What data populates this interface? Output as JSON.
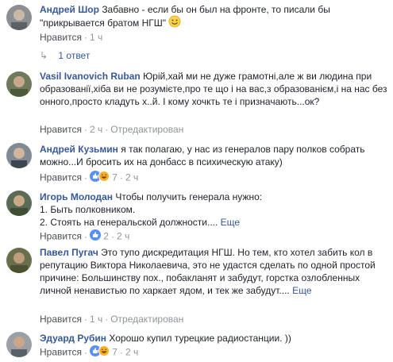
{
  "comments": [
    {
      "author": "Андрей Шор",
      "text": "Забавно - если бы он был на фронте, то писали бы \"прикрывается братом НГШ\"",
      "emoji": "smile-emoji",
      "like": "Нравится",
      "time": "1 ч",
      "replies": "1 ответ"
    },
    {
      "author": "Vasil Ivanovich Ruban",
      "text": "Юрій,хай ми не дуже грамотні,але ж ви людина при образованії,хіба ви не розумієте,про те що і на вас,з образованієм,і на нас без онного,просто кладуть х..й. І кому хочкть те і призначають...ок?",
      "like": "Нравится",
      "time": "2 ч",
      "edited": "Отредактирован"
    },
    {
      "author": "Андрей Кузьмин",
      "text": "я так полагаю, у нас из генералов пару полков собрать можно...И бросить их на донбасс в психическую атаку)",
      "like": "Нравится",
      "reaction_count": "7",
      "time": "2 ч"
    },
    {
      "author": "Игорь Молодан",
      "text_intro": "Чтобы получить генерала нужно:",
      "text_line1": "1. Быть полковником.",
      "text_line2": "2. Стоять на генеральской должности....",
      "more": "Еще",
      "like": "Нравится",
      "reaction_count": "2",
      "time": "2 ч"
    },
    {
      "author": "Павел Пугач",
      "text": "Это тупо дискредитация НГШ. Но тем, кто хотел забить кол в репутацию Виктора Николаевича, это не удастся сделать по одной простой причине: Большинству пох., побакланят и забудут, горстка озлобленных личной ненавистью по харкает ядом, и тек же забудут....",
      "more": "Еще",
      "like": "Нравится",
      "time": "1 ч",
      "edited": "Отредактирован"
    },
    {
      "author": "Эдуард Рубин",
      "text": "Хорошо купил турецкие радиостанции. ))",
      "like": "Нравится",
      "reaction_count": "7",
      "time": "2 ч"
    }
  ],
  "colors": {
    "author": "#365899",
    "text": "#1d2129",
    "meta": "#90949c",
    "like_blue": "#5890ff",
    "haha_yellow": "#f7b125"
  }
}
